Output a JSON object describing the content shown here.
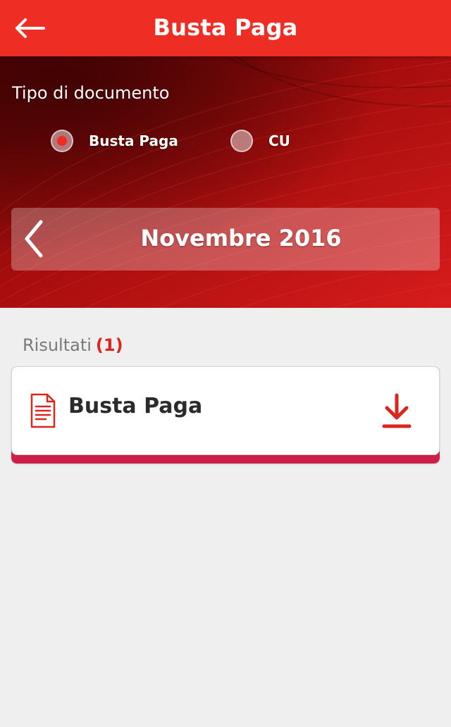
{
  "header": {
    "title": "Busta Paga",
    "back_icon": "arrow-left-icon"
  },
  "filters": {
    "doc_type_label": "Tipo di documento",
    "options": [
      {
        "label": "Busta Paga",
        "selected": true
      },
      {
        "label": "CU",
        "selected": false
      }
    ]
  },
  "month_picker": {
    "label": "Novembre 2016",
    "prev_icon": "chevron-left-icon"
  },
  "results": {
    "label": "Risultati",
    "count": "(1)",
    "items": [
      {
        "title": "Busta Paga",
        "icon": "document-icon",
        "action_icon": "download-icon"
      }
    ]
  },
  "colors": {
    "brand_red": "#ee2e24",
    "accent_pink": "#cc1f4a",
    "background": "#efefef"
  }
}
